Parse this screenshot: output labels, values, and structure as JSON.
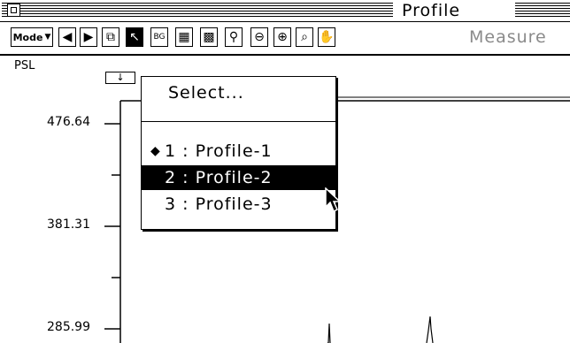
{
  "window": {
    "title": "Profile"
  },
  "toolbar": {
    "mode_label": "Mode",
    "measure_label": "Measure",
    "buttons": [
      {
        "icon": "arrow-left-icon",
        "glyph": "◀"
      },
      {
        "icon": "arrow-right-icon",
        "glyph": "▶"
      },
      {
        "icon": "duplicate-window-icon",
        "glyph": "⧉"
      },
      {
        "icon": "pointer-icon",
        "glyph": "↖",
        "selected": true
      },
      {
        "icon": "background-icon",
        "glyph": "BG"
      },
      {
        "icon": "peak-hatch-icon",
        "glyph": "▦"
      },
      {
        "icon": "peak-fill-icon",
        "glyph": "▩"
      },
      {
        "icon": "probe-icon",
        "glyph": "⚲"
      },
      {
        "icon": "zoom-out-icon",
        "glyph": "⊖"
      },
      {
        "icon": "zoom-axis-icon",
        "glyph": "⊕"
      },
      {
        "icon": "magnifier-icon",
        "glyph": "⌕"
      },
      {
        "icon": "hand-icon",
        "glyph": "✋"
      }
    ]
  },
  "plot": {
    "y_unit": "PSL",
    "y_ticks": [
      "476.64",
      "381.31",
      "285.99"
    ]
  },
  "dropdown": {
    "select_label": "Select...",
    "items": [
      {
        "label": "1 : Profile-1",
        "checked": true,
        "highlighted": false
      },
      {
        "label": "2 : Profile-2",
        "checked": false,
        "highlighted": true
      },
      {
        "label": "3 : Profile-3",
        "checked": false,
        "highlighted": false
      }
    ],
    "check_glyph": "◆"
  }
}
